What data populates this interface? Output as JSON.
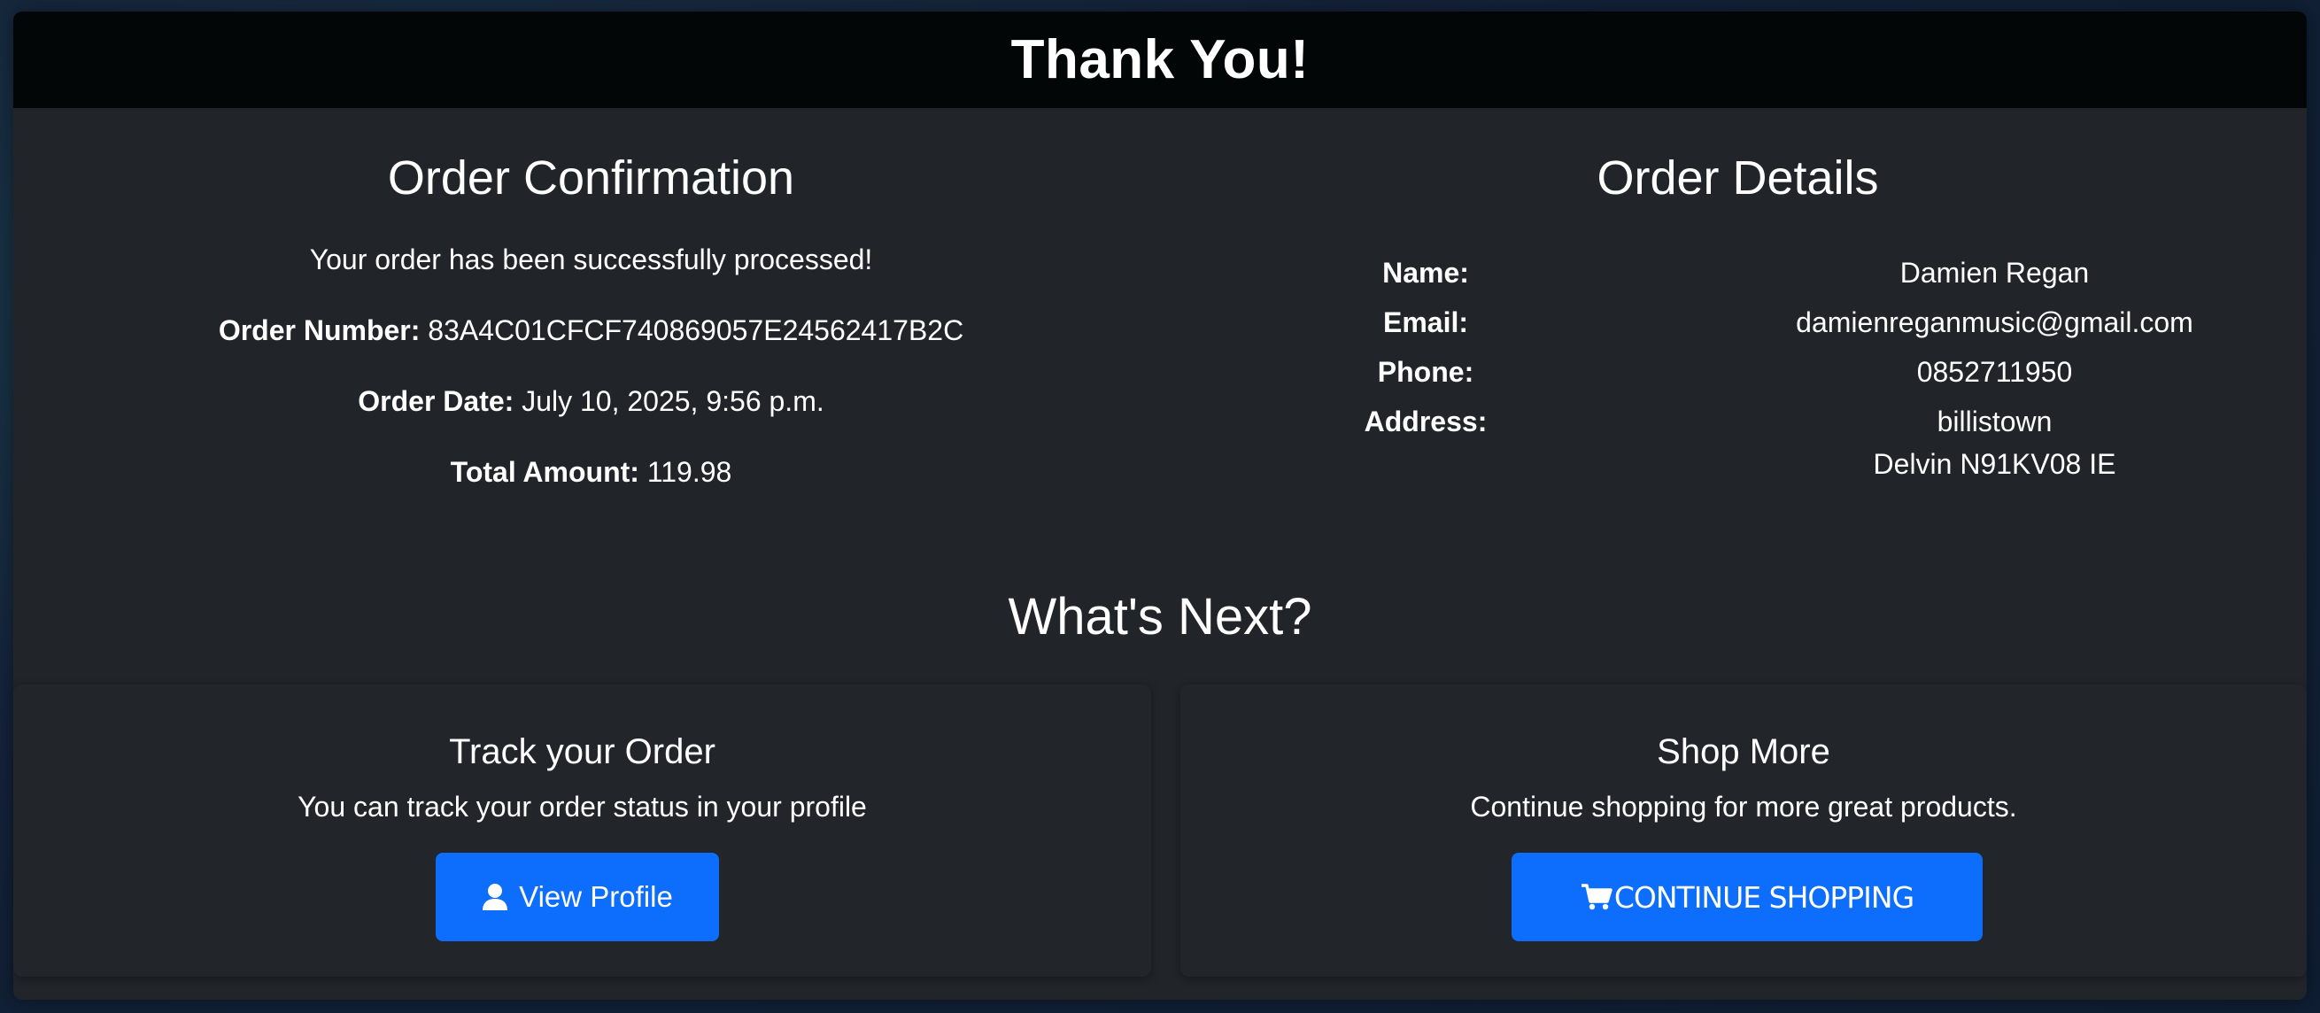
{
  "header": {
    "title": "Thank You!"
  },
  "confirmation": {
    "title": "Order Confirmation",
    "message": "Your order has been successfully processed!",
    "order_number_label": "Order Number:",
    "order_number": "83A4C01CFCF740869057E24562417B2C",
    "order_date_label": "Order Date:",
    "order_date": "July 10, 2025, 9:56 p.m.",
    "total_label": "Total Amount:",
    "total": "119.98"
  },
  "details": {
    "title": "Order Details",
    "name_label": "Name:",
    "name": "Damien Regan",
    "email_label": "Email:",
    "email": "damienreganmusic@gmail.com",
    "phone_label": "Phone:",
    "phone": "0852711950",
    "address_label": "Address:",
    "address_line1": "billistown",
    "address_line2": "Delvin N91KV08 IE"
  },
  "next": {
    "title": "What's Next?",
    "track": {
      "title": "Track your Order",
      "text": "You can track your order status in your profile",
      "button": "View Profile",
      "icon": "user-icon"
    },
    "shop": {
      "title": "Shop More",
      "text": "Continue shopping for more great products.",
      "button": "CONTINUE SHOPPING",
      "icon": "cart-icon"
    }
  },
  "colors": {
    "header_bg": "#030606",
    "card_bg": "#212529",
    "button_primary": "#0d6efd"
  }
}
